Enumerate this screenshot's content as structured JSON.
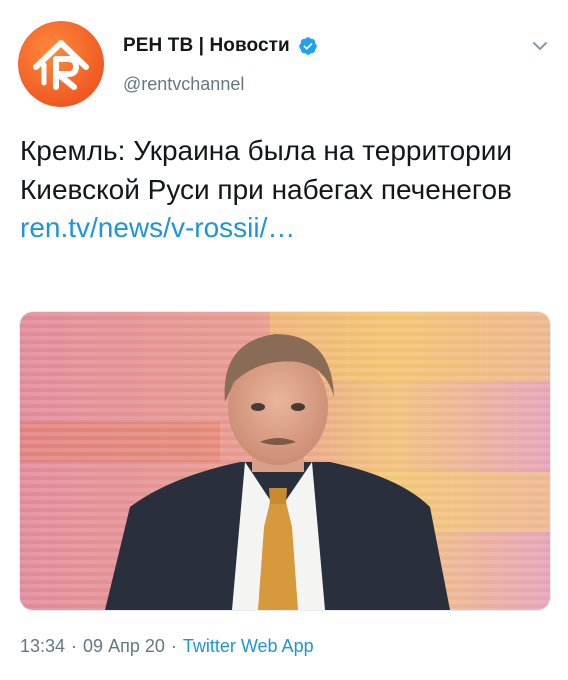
{
  "account": {
    "display_name": "РЕН ТВ | Новости",
    "handle": "@rentvchannel",
    "verified": true,
    "avatar_icon": "rentv-logo-icon",
    "avatar_color": "#f05a22"
  },
  "tweet": {
    "text": "Кремль: Украина была на территории Киевской Руси при набегах печенегов ",
    "link_text": "ren.tv/news/v-rossii/…",
    "media_description_icon": "photo-icon"
  },
  "meta": {
    "time": "13:34",
    "date": "09 Апр 20",
    "separator": "·",
    "source": "Twitter Web App"
  },
  "icons": {
    "verified": "verified-badge-icon",
    "menu": "chevron-down-icon"
  },
  "colors": {
    "link": "#1b95e0",
    "secondary_text": "#657786",
    "verified": "#1da1f2"
  }
}
